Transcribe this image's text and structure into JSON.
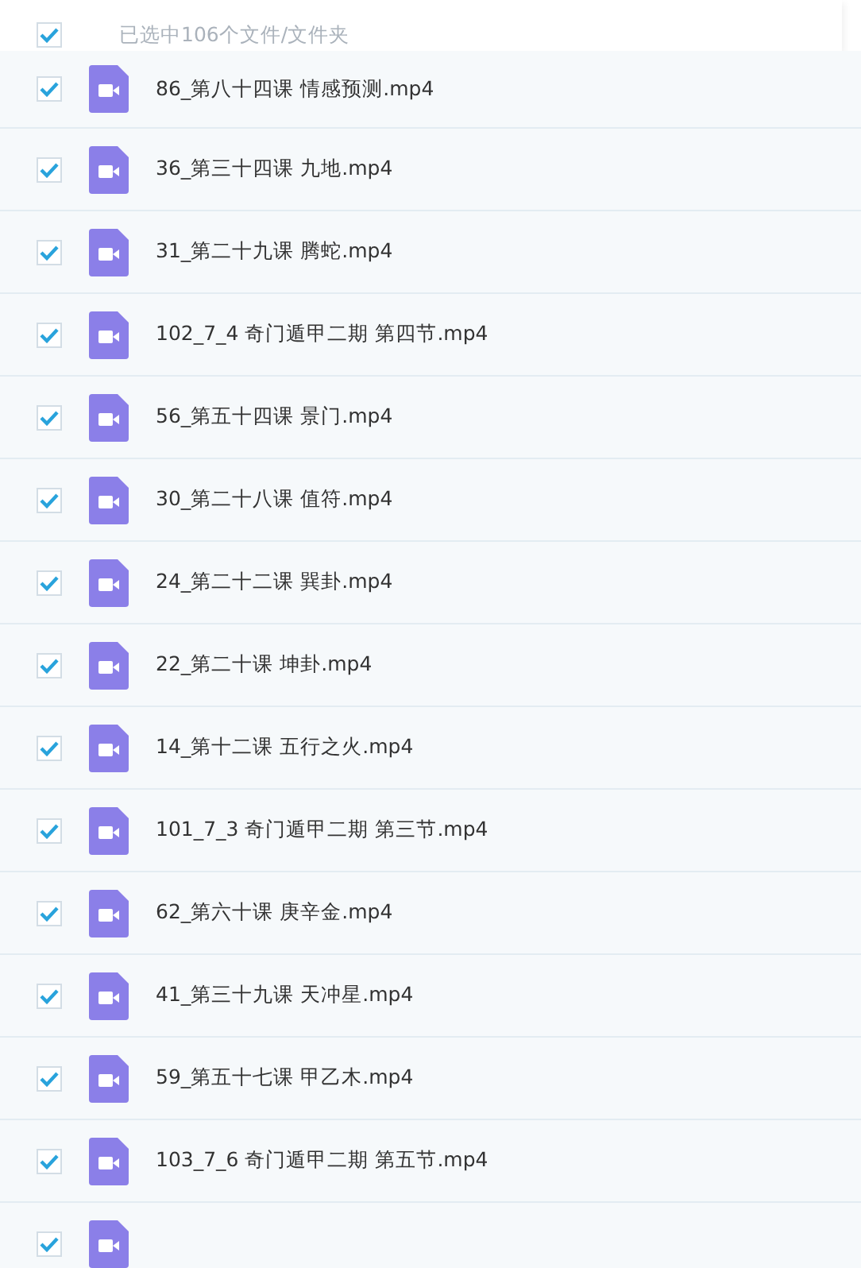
{
  "header": {
    "checked": true,
    "label": "已选中106个文件/文件夹"
  },
  "files": [
    {
      "name": "86_第八十四课 情感预测.mp4",
      "checked": true
    },
    {
      "name": "36_第三十四课 九地.mp4",
      "checked": true
    },
    {
      "name": "31_第二十九课 腾蛇.mp4",
      "checked": true
    },
    {
      "name": "102_7_4 奇门遁甲二期 第四节.mp4",
      "checked": true
    },
    {
      "name": "56_第五十四课 景门.mp4",
      "checked": true
    },
    {
      "name": "30_第二十八课 值符.mp4",
      "checked": true
    },
    {
      "name": "24_第二十二课 巽卦.mp4",
      "checked": true
    },
    {
      "name": "22_第二十课 坤卦.mp4",
      "checked": true
    },
    {
      "name": "14_第十二课 五行之火.mp4",
      "checked": true
    },
    {
      "name": "101_7_3 奇门遁甲二期 第三节.mp4",
      "checked": true
    },
    {
      "name": "62_第六十课 庚辛金.mp4",
      "checked": true
    },
    {
      "name": "41_第三十九课 天冲星.mp4",
      "checked": true
    },
    {
      "name": "59_第五十七课 甲乙木.mp4",
      "checked": true
    },
    {
      "name": "103_7_6 奇门遁甲二期 第五节.mp4",
      "checked": true
    },
    {
      "checked": true
    }
  ]
}
